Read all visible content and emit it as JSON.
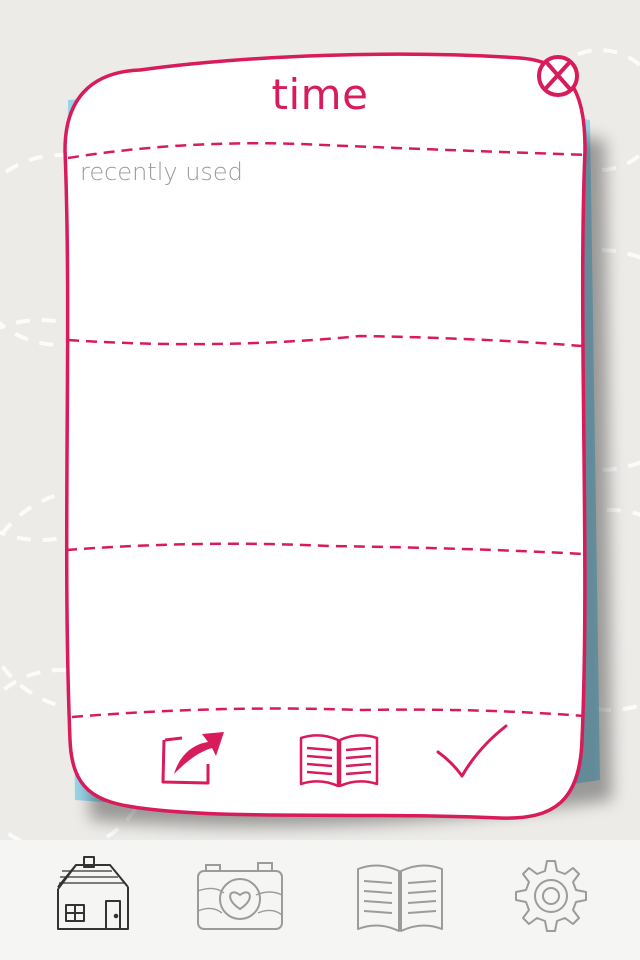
{
  "dialog": {
    "title": "time",
    "sections": [
      {
        "label": "recently used",
        "items": []
      },
      {
        "label": "",
        "items": []
      },
      {
        "label": "",
        "items": []
      }
    ]
  },
  "actions": [
    {
      "name": "share",
      "icon": "share-arrow-icon"
    },
    {
      "name": "library",
      "icon": "open-book-icon"
    },
    {
      "name": "confirm",
      "icon": "checkmark-icon"
    }
  ],
  "close": {
    "icon": "close-circle-x-icon"
  },
  "nav": [
    {
      "name": "home",
      "icon": "house-icon",
      "active": true
    },
    {
      "name": "camera",
      "icon": "camera-heart-icon",
      "active": false
    },
    {
      "name": "book",
      "icon": "book-icon",
      "active": false
    },
    {
      "name": "settings",
      "icon": "gear-icon",
      "active": false
    }
  ],
  "colors": {
    "accent": "#d81b5b",
    "background": "#ecebe8",
    "card": "#ffffff",
    "label_gray": "#9a9a9a",
    "nav_gray": "#9b9b9b",
    "shadow_blue": "#8fd3ea"
  }
}
